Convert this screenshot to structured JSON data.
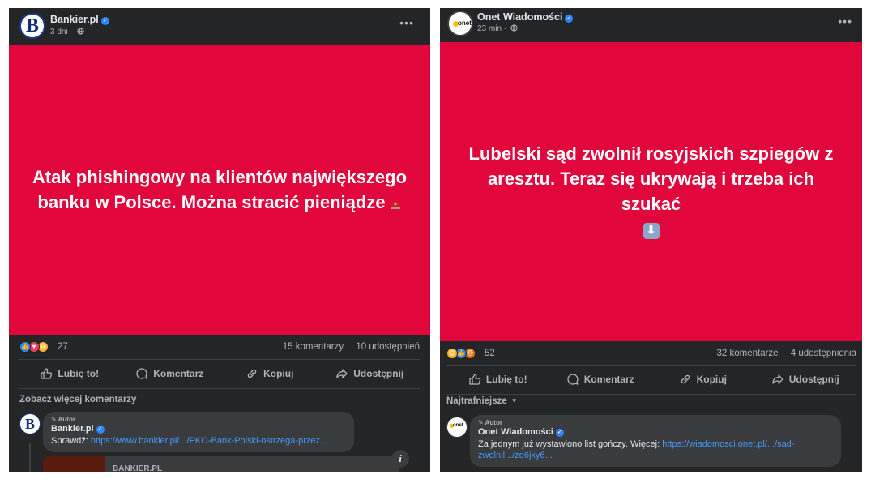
{
  "left_post": {
    "page_name": "Bankier.pl",
    "time": "3 dni",
    "separator": "·",
    "more": "•••",
    "image_text": "Atak phishingowy na klientów największego banku w Polsce. Można stracić pieniądze",
    "reaction_count": "27",
    "comments": "15 komentarzy",
    "shares": "10 udostępnień",
    "actions": {
      "like": "Lubię to!",
      "comment": "Komentarz",
      "copy": "Kopiuj",
      "share": "Udostępnij"
    },
    "see_more_comments": "Zobacz więcej komentarzy",
    "comment": {
      "badge": "Autor",
      "author": "Bankier.pl",
      "text_prefix": "Sprawdź: ",
      "link": "https://www.bankier.pl/.../PKO-Bank-Polski-ostrzega-przez..."
    },
    "preview_title": "BANKIER.PL",
    "info_icon": "i"
  },
  "right_post": {
    "page_name": "Onet Wiadomości",
    "time": "23 min",
    "separator": "·",
    "more": "•••",
    "image_text": "Lubelski sąd zwolnił rosyjskich szpiegów z aresztu. Teraz się ukrywają i trzeba ich szukać",
    "reaction_count": "52",
    "comments": "32 komentarze",
    "shares": "4 udostępnienia",
    "actions": {
      "like": "Lubię to!",
      "comment": "Komentarz",
      "copy": "Kopiuj",
      "share": "Udostępnij"
    },
    "sort_label": "Najtrafniejsze",
    "comment": {
      "badge": "Autor",
      "author": "Onet Wiadomości",
      "text_prefix": "Za jednym już wystawiono list gończy. Więcej: ",
      "link_line1": "https://wiadomosci.onet.pl/.../sad-",
      "link_line2": "zwolnil.../zq6jxy6..."
    }
  },
  "icons": {
    "bankier_logo_letter": "B",
    "onet_logo_word": "onet",
    "verified": "verified-badge-icon",
    "globe": "globe-icon",
    "siren": "siren-emoji-icon",
    "down_arrow": "down-arrow-emoji-icon"
  },
  "colors": {
    "panel_bg": "#242526",
    "image_bg": "#e1063c",
    "link": "#4599ff",
    "verified": "#2d88ff"
  }
}
